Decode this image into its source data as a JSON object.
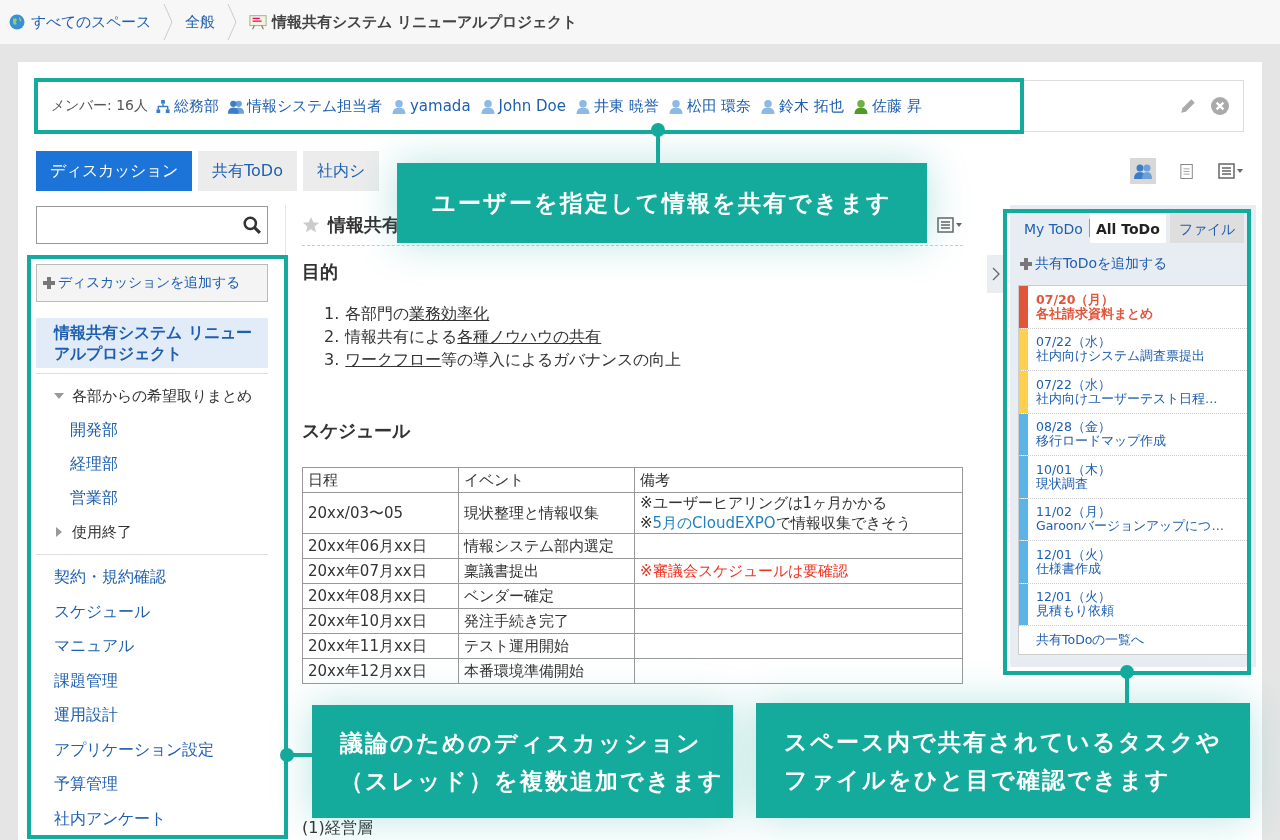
{
  "breadcrumb": [
    {
      "label": "すべてのスペース",
      "kind": "home"
    },
    {
      "label": "全般",
      "kind": "link"
    },
    {
      "label": "情報共有システム リニューアルプロジェクト",
      "kind": "current"
    }
  ],
  "members": {
    "count_label": "メンバー: 16人",
    "items": [
      {
        "label": "総務部",
        "kind": "org"
      },
      {
        "label": "情報システム担当者",
        "kind": "group"
      },
      {
        "label": "yamada",
        "kind": "user",
        "online": false
      },
      {
        "label": "John Doe",
        "kind": "user",
        "online": false
      },
      {
        "label": "井東 暁誉",
        "kind": "user",
        "online": false
      },
      {
        "label": "松田 環奈",
        "kind": "user",
        "online": false
      },
      {
        "label": "鈴木 拓也",
        "kind": "user",
        "online": false
      },
      {
        "label": "佐藤 昇",
        "kind": "user",
        "online": true
      }
    ]
  },
  "tabs": [
    {
      "label": "ディスカッション",
      "selected": true
    },
    {
      "label": "共有ToDo",
      "selected": false
    },
    {
      "label": "社内シ",
      "selected": false
    }
  ],
  "view_buttons": [
    {
      "kind": "members",
      "selected": true
    },
    {
      "kind": "notes",
      "selected": false
    },
    {
      "kind": "menu",
      "selected": false
    }
  ],
  "sidebar": {
    "add_button": "ディスカッションを追加する",
    "threads": [
      {
        "label": "情報共有システム リニューアルプロジェクト",
        "selected": true
      }
    ],
    "tree": [
      {
        "label": "各部からの希望取りまとめ",
        "expanded": true,
        "children": [
          {
            "label": "開発部"
          },
          {
            "label": "経理部"
          },
          {
            "label": "営業部"
          }
        ]
      },
      {
        "label": "使用終了",
        "expanded": false
      }
    ],
    "links": [
      {
        "label": "契約・規約確認",
        "selected": false
      },
      {
        "label": "スケジュール",
        "selected": false
      },
      {
        "label": "マニュアル",
        "selected": false
      },
      {
        "label": "課題管理",
        "selected": false
      },
      {
        "label": "運用設計",
        "selected": false
      },
      {
        "label": "アプリケーション設定",
        "selected": false
      },
      {
        "label": "予算管理",
        "selected": false
      },
      {
        "label": "社内アンケート",
        "selected": false
      }
    ]
  },
  "thread": {
    "title": "情報共有",
    "purpose_heading": "目的",
    "purpose_items": [
      {
        "num": "1.",
        "parts": [
          {
            "text": "各部門の",
            "kind": "plain"
          },
          {
            "text": "業務効率化",
            "kind": "link"
          }
        ]
      },
      {
        "num": "2.",
        "parts": [
          {
            "text": "情報共有による",
            "kind": "plain"
          },
          {
            "text": "各種ノウハウの共有",
            "kind": "link"
          }
        ]
      },
      {
        "num": "3.",
        "parts": [
          {
            "text": "ワークフロー",
            "kind": "link"
          },
          {
            "text": "等の導入によるガバナンスの向上",
            "kind": "plain"
          }
        ]
      }
    ],
    "schedule_heading": "スケジュール",
    "table": {
      "columns": [
        "日程",
        "イベント",
        "備考"
      ],
      "rows": [
        {
          "date": "20xx/03〜05",
          "event": "現状整理と情報収集",
          "note": [
            [
              {
                "text": "※ユーザーヒアリングは1ヶ月かかる",
                "kind": "plain"
              }
            ],
            [
              {
                "text": "※",
                "kind": "plain"
              },
              {
                "text": "5月のCloudEXPO",
                "kind": "link"
              },
              {
                "text": "で情報収集できそう",
                "kind": "plain"
              }
            ]
          ]
        },
        {
          "date": "20xx年06月xx日",
          "event": "情報システム部内選定",
          "note": []
        },
        {
          "date": "20xx年07月xx日",
          "event": "稟議書提出",
          "note": [
            [
              {
                "text": "※審議会スケジュールは要確認",
                "kind": "alert"
              }
            ]
          ]
        },
        {
          "date": "20xx年08月xx日",
          "event": "ベンダー確定",
          "note": []
        },
        {
          "date": "20xx年10月xx日",
          "event": "発注手続き完了",
          "note": []
        },
        {
          "date": "20xx年11月xx日",
          "event": "テスト運用開始",
          "note": []
        },
        {
          "date": "20xx年12月xx日",
          "event": "本番環境準備開始",
          "note": []
        }
      ]
    },
    "paragraph": "(1)経営層"
  },
  "todo": {
    "tabs": [
      {
        "label": "My ToDo",
        "selected": false,
        "kind": "link"
      },
      {
        "label": "All ToDo",
        "selected": true,
        "kind": "link"
      },
      {
        "label": "ファイル",
        "selected": false,
        "kind": "tab"
      }
    ],
    "add_link": "共有ToDoを追加する",
    "items": [
      {
        "date": "07/20（月）",
        "title": "各社請求資料まとめ",
        "color": "#e2553b",
        "overdue": true
      },
      {
        "date": "07/22（水）",
        "title": "社内向けシステム調査票提出",
        "color": "#fdd14f",
        "overdue": false
      },
      {
        "date": "07/22（水）",
        "title": "社内向けユーザーテスト日程…",
        "color": "#fdd14f",
        "overdue": false
      },
      {
        "date": "08/28（金）",
        "title": "移行ロードマップ作成",
        "color": "#5ab4e5",
        "overdue": false
      },
      {
        "date": "10/01（木）",
        "title": "現状調査",
        "color": "#5ab4e5",
        "overdue": false
      },
      {
        "date": "11/02（月）",
        "title": "Garoonバージョンアップにつ…",
        "color": "#5ab4e5",
        "overdue": false
      },
      {
        "date": "12/01（火）",
        "title": "仕様書作成",
        "color": "#5ab4e5",
        "overdue": false
      },
      {
        "date": "12/01（火）",
        "title": "見積もり依頼",
        "color": "#5ab4e5",
        "overdue": false
      }
    ],
    "list_link": "共有ToDoの一覧へ"
  },
  "callouts": [
    {
      "lines": [
        "ユーザーを指定して情報を共有できます"
      ]
    },
    {
      "lines": [
        "議論のためのディスカッション",
        "（スレッド）を複数追加できます"
      ]
    },
    {
      "lines": [
        "スペース内で共有されているタスクや",
        "ファイルをひと目で確認できます"
      ]
    }
  ]
}
